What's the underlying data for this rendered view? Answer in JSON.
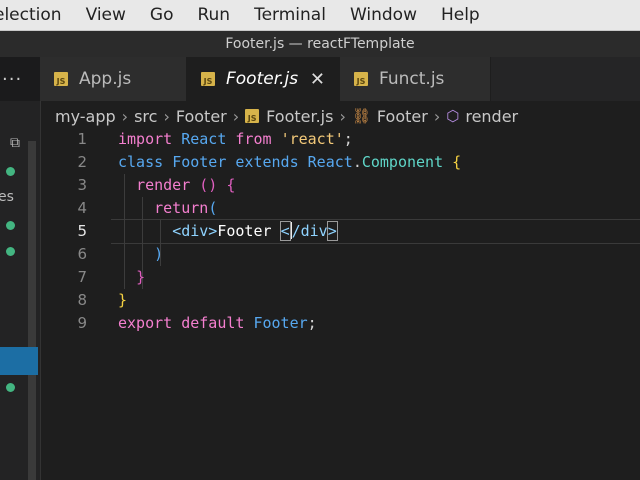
{
  "menubar": {
    "items": [
      "election",
      "View",
      "Go",
      "Run",
      "Terminal",
      "Window",
      "Help"
    ]
  },
  "window": {
    "title": "Footer.js — reactFTemplate"
  },
  "tabs": [
    {
      "label": "App.js",
      "icon": "js-file-icon"
    },
    {
      "label": "Footer.js",
      "icon": "js-file-icon",
      "active": true,
      "close": "✕"
    },
    {
      "label": "Funct.js",
      "icon": "js-file-icon"
    }
  ],
  "tab_overflow": "···",
  "breadcrumb": {
    "root": "my-app",
    "folder1": "src",
    "folder2": "Footer",
    "file": "Footer.js",
    "class_name": "Footer",
    "method": "render"
  },
  "sidebar": {
    "partial_label": "es"
  },
  "editor": {
    "line_numbers": [
      "1",
      "2",
      "3",
      "4",
      "5",
      "6",
      "7",
      "8",
      "9"
    ],
    "current_line": "5",
    "code": {
      "l1": {
        "import": "import",
        "react": "React",
        "from": "from",
        "module": "'react'",
        "semi": ";"
      },
      "l2": {
        "class": "class",
        "name": "Footer",
        "extends": "extends",
        "react": "React",
        "dot": ".",
        "component": "Component",
        "brace": "{"
      },
      "l3": {
        "render": "render",
        "parens": "()",
        "brace": "{"
      },
      "l4": {
        "return": "return",
        "paren": "("
      },
      "l5": {
        "open_tag": "<div>",
        "text": "Footer ",
        "close_lt": "<",
        "close_rest": "/div",
        "close_gt": ">"
      },
      "l6": {
        "paren": ")"
      },
      "l7": {
        "brace": "}"
      },
      "l8": {
        "brace": "}"
      },
      "l9": {
        "export": "export",
        "default": "default",
        "name": "Footer",
        "semi": ";"
      }
    }
  },
  "colors": {
    "keyword": "#f47fcf",
    "class_name": "#57a8f0",
    "component": "#5fd6c8",
    "string": "#f3c979",
    "status_dot": "#43b581",
    "selection": "#1c6ea4"
  }
}
